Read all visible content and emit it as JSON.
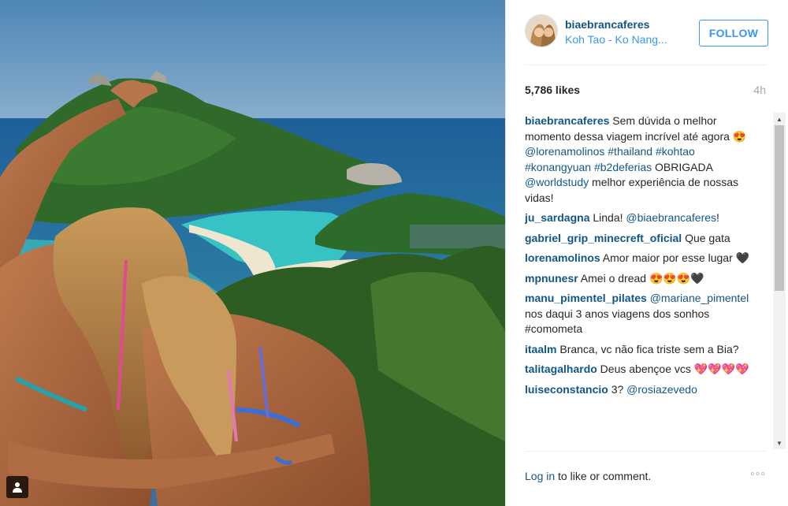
{
  "post": {
    "username": "biaebrancaferes",
    "location": "Koh Tao - Ko Nang...",
    "follow_label": "FOLLOW",
    "likes": "5,786 likes",
    "time": "4h"
  },
  "caption": {
    "user": "biaebrancaferes",
    "text1": " Sem dúvida o melhor momento dessa viagem incrível até agora ",
    "emoji": "😍",
    "mention": " @lorenamolinos",
    "tags": " #thailand #kohtao #konangyuan #b2deferias",
    "text2": " OBRIGADA ",
    "mention2": "@worldstudy",
    "text3": " melhor experiência de nossas vidas!"
  },
  "comments": [
    {
      "user": "ju_sardagna",
      "text": " Linda! ",
      "link": "@biaebrancaferes",
      "tail": "!"
    },
    {
      "user": "gabriel_grip_minecreft_oficial",
      "text": " Que gata",
      "link": "",
      "tail": ""
    },
    {
      "user": "lorenamolinos",
      "text": " Amor maior por esse lugar 🖤",
      "link": "",
      "tail": ""
    },
    {
      "user": "mpnunesr",
      "text": " Amei o dread 😍😍😍🖤",
      "link": "",
      "tail": ""
    },
    {
      "user": "manu_pimentel_pilates",
      "text": " ",
      "link": "@mariane_pimentel",
      "tail": " nos daqui 3 anos viagens dos sonhos #comometa"
    },
    {
      "user": "itaalm",
      "text": " Branca, vc não fica triste sem a Bia?",
      "link": "",
      "tail": ""
    },
    {
      "user": "talitagalhardo",
      "text": " Deus abençoe vcs 💖💖💖💖",
      "link": "",
      "tail": ""
    },
    {
      "user": "luiseconstancio",
      "text": " 3? ",
      "link": "@rosiazevedo",
      "tail": ""
    }
  ],
  "footer": {
    "login": "Log in",
    "rest": " to like or comment.",
    "more": "◦◦◦"
  },
  "colors": {
    "link": "#125688",
    "accent": "#3897f0",
    "muted": "#a5a7aa"
  },
  "icons": {
    "tag": "person-tag-icon",
    "more": "more-options-icon"
  }
}
